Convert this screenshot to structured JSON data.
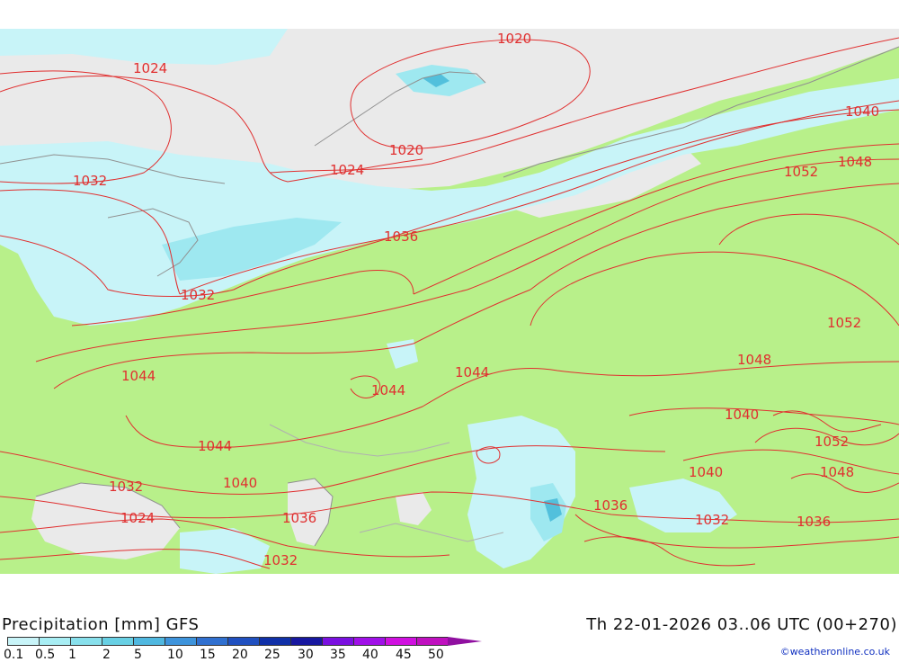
{
  "map": {
    "isobars": [
      "1020",
      "1020",
      "1024",
      "1024",
      "1032",
      "1032",
      "1036",
      "1040",
      "1040",
      "1044",
      "1044",
      "1044",
      "1044",
      "1048",
      "1048",
      "1052",
      "1052",
      "1040",
      "1040",
      "1052",
      "1048",
      "1036",
      "1032",
      "1036",
      "1040",
      "1036",
      "1032",
      "1032",
      "1024"
    ],
    "colors": {
      "land": "#b8f08a",
      "sea": "#eaeaea",
      "precip_light": "#c8f4f8",
      "precip_mid": "#9ee8f0",
      "precip_heavy": "#52c0dc",
      "isobar": "#e03030",
      "coast": "#909090"
    }
  },
  "footer": {
    "title_left": "Precipitation [mm] GFS",
    "title_right": "Th 22-01-2026 03..06 UTC (00+270)",
    "colorbar_labels": [
      "0.1",
      "0.5",
      "1",
      "2",
      "5",
      "10",
      "15",
      "20",
      "25",
      "30",
      "35",
      "40",
      "45",
      "50"
    ],
    "colorbar_colors": [
      "#c8f4f8",
      "#a8eef4",
      "#88e0ec",
      "#68d0e4",
      "#50b8e0",
      "#3e94dc",
      "#3070d0",
      "#2050c0",
      "#1030a8",
      "#1818a0",
      "#7a10e0",
      "#a010e8",
      "#d010e0",
      "#c010c0"
    ],
    "credit": "©weatheronline.co.uk"
  }
}
